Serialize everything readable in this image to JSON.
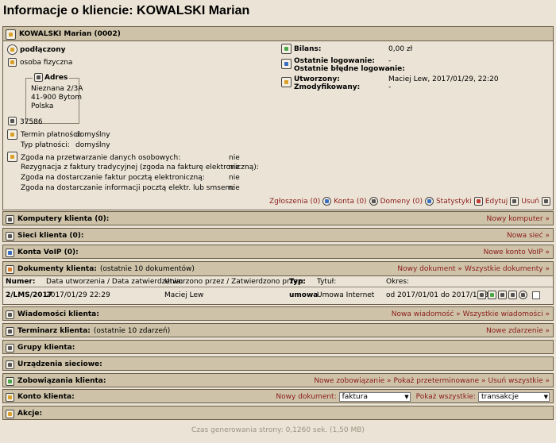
{
  "page": {
    "title": "Informacje o kliencie: KOWALSKI Marian"
  },
  "customer": {
    "header": "KOWALSKI Marian (0002)",
    "status": "podłączony",
    "type": "osoba fizyczna",
    "address_label": "Adres",
    "address_lines": [
      "Nieznana 2/3A",
      "41-900 Bytom",
      "Polska"
    ],
    "id_number": "37586",
    "payment": {
      "term_label": "Termin płatności:",
      "term_value": "domyślny",
      "type_label": "Typ płatności:",
      "type_value": "domyślny"
    },
    "consents": [
      {
        "label": "Zgoda na przetwarzanie danych osobowych:",
        "value": "nie"
      },
      {
        "label": "Rezygnacja z faktury tradycyjnej (zgoda na fakturę elektroniczną):",
        "value": "nie"
      },
      {
        "label": "Zgoda na dostarczanie faktur pocztą elektroniczną:",
        "value": "nie"
      },
      {
        "label": "Zgoda na dostarczanie informacji pocztą elektr. lub smsem:",
        "value": "nie"
      }
    ],
    "balance_label": "Bilans:",
    "balance_value": "0,00 zł",
    "last_login_label": "Ostatnie logowanie:",
    "last_login_value": "-",
    "last_failed_label": "Ostatnie błędne logowanie:",
    "last_failed_value": "-",
    "created_label": "Utworzony:",
    "created_value": "Maciej Lew, 2017/01/29, 22:20",
    "modified_label": "Zmodyfikowany:",
    "modified_value": "-",
    "actions": [
      "Zgłoszenia (0)",
      "Konta (0)",
      "Domeny (0)",
      "Statystyki",
      "Edytuj",
      "Usuń"
    ]
  },
  "sections": {
    "computers": {
      "title": "Komputery klienta (0):",
      "link": "Nowy komputer »"
    },
    "networks": {
      "title": "Sieci klienta (0):",
      "link": "Nowa sieć »"
    },
    "voip": {
      "title": "Konta VoIP (0):",
      "link": "Nowe konto VoIP »"
    },
    "documents": {
      "title": "Dokumenty klienta:",
      "subtitle": "(ostatnie 10 dokumentów)",
      "link1": "Nowy dokument »",
      "link2": "Wszystkie dokumenty »",
      "columns": [
        "Numer:",
        "Data utworzenia / Data zatwierdzenia:",
        "Utworzono przez / Zatwierdzono przez:",
        "Typ:",
        "Tytuł:",
        "Okres:"
      ],
      "rows": [
        {
          "number": "2/LMS/2017",
          "date": "2017/01/29 22:29",
          "by": "Maciej Lew",
          "type": "umowa",
          "title": "Umowa Internet",
          "period": "od 2017/01/01 do 2017/12/31"
        }
      ]
    },
    "messages": {
      "title": "Wiadomości klienta:",
      "link1": "Nowa wiadomość »",
      "link2": "Wszystkie wiadomości »"
    },
    "timetable": {
      "title": "Terminarz klienta:",
      "subtitle": "(ostatnie 10 zdarzeń)",
      "link": "Nowe zdarzenie »"
    },
    "groups": {
      "title": "Grupy klienta:"
    },
    "devices": {
      "title": "Urządzenia sieciowe:"
    },
    "liabilities": {
      "title": "Zobowiązania klienta:",
      "link1": "Nowe zobowiązanie »",
      "link2": "Pokaż przeterminowane »",
      "link3": "Usuń wszystkie »"
    },
    "account": {
      "title": "Konto klienta:",
      "newdoc_label": "Nowy dokument:",
      "newdoc_value": "faktura",
      "showall_label": "Pokaż wszystkie:",
      "showall_value": "transakcje"
    },
    "actions": {
      "title": "Akcje:"
    }
  },
  "footer": "Czas generowania strony: 0,1260 sek. (1,50 MB)"
}
